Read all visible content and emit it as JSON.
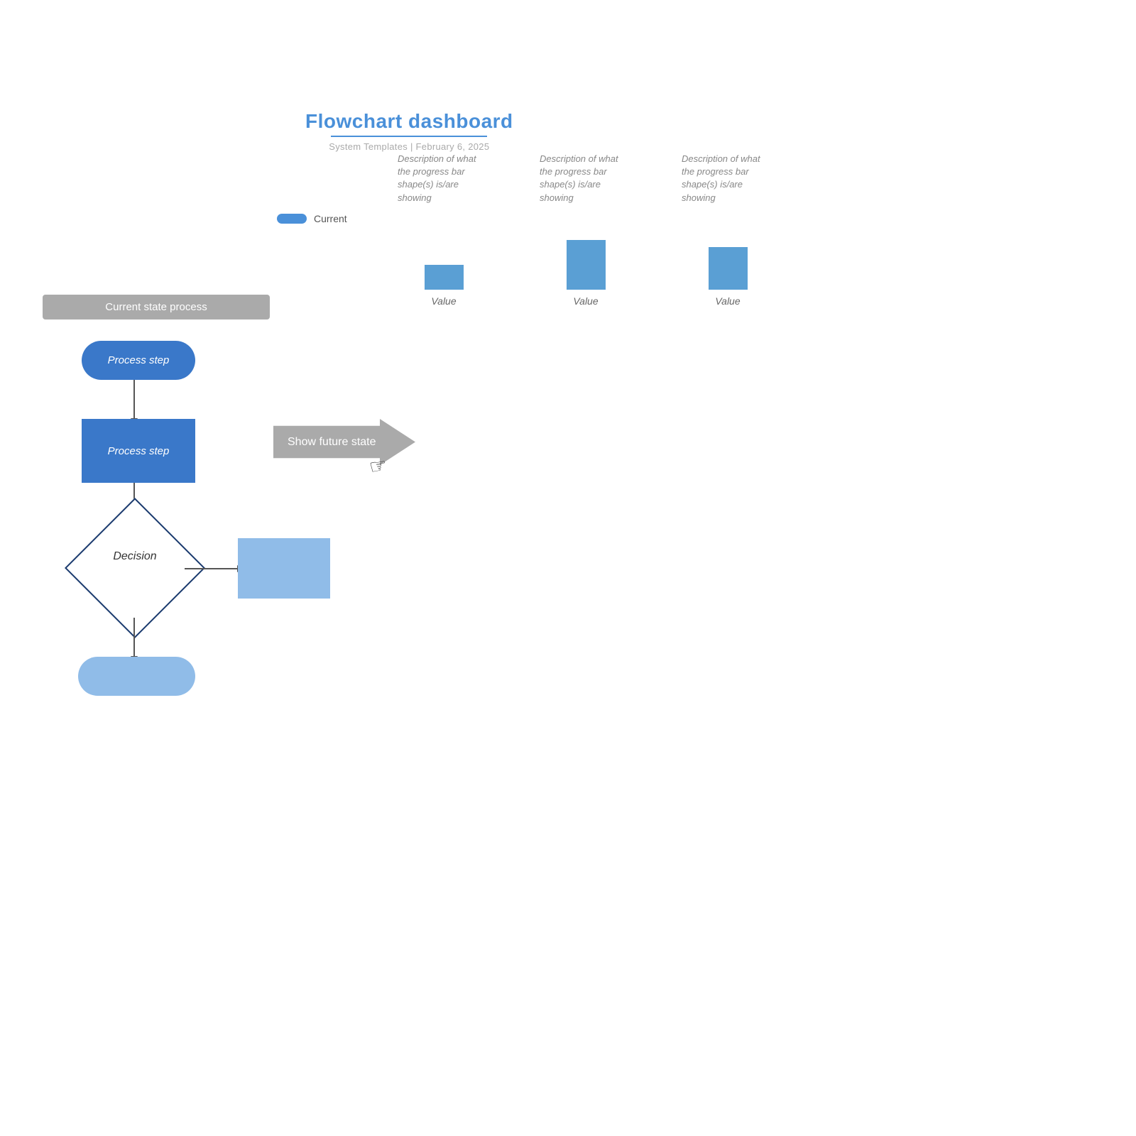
{
  "header": {
    "title": "Flowchart dashboard",
    "subtitle": "System Templates  |  February 6, 2025"
  },
  "legend": {
    "label": "Current"
  },
  "charts": [
    {
      "description": "Description of what the progress bar shape(s) is/are showing",
      "bar_height": "short",
      "value_label": "Value"
    },
    {
      "description": "Description of what the progress bar shape(s) is/are showing",
      "bar_height": "medium",
      "value_label": "Value"
    },
    {
      "description": "Description of what the progress bar shape(s) is/are showing",
      "bar_height": "tall",
      "value_label": "Value"
    }
  ],
  "flowchart": {
    "section_label": "Current state process",
    "process_step_1": "Process step",
    "process_step_2": "Process step",
    "decision_label": "Decision",
    "show_future_state": "Show future state"
  }
}
